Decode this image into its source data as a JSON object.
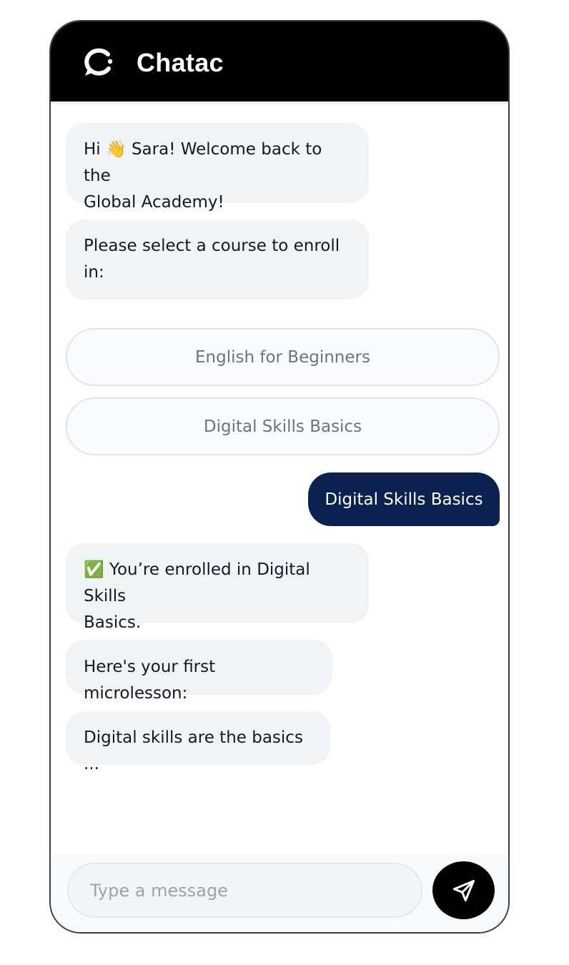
{
  "app": {
    "name": "Chatac"
  },
  "messages": [
    {
      "prefix": "Hi",
      "emoji": "👋",
      "text": "Sara! Welcome back to the",
      "line2": "Global Academy!"
    },
    {
      "text": "Please select a course to enroll",
      "line2": "in:"
    }
  ],
  "options": [
    "English for Beginners",
    "Digital Skills Basics"
  ],
  "user_message": "Digital Skills Basics",
  "replies": [
    {
      "emoji": "✅",
      "text": "You’re enrolled in Digital Skills",
      "line2": "Basics."
    },
    {
      "text": "Here's your first microlesson:"
    },
    {
      "text": "Digital skills are the basics ..."
    }
  ],
  "composer": {
    "placeholder": "Type a message"
  },
  "colors": {
    "header": "#000000",
    "user_bubble": "#0b2150",
    "bot_bubble": "#f2f3f5"
  }
}
